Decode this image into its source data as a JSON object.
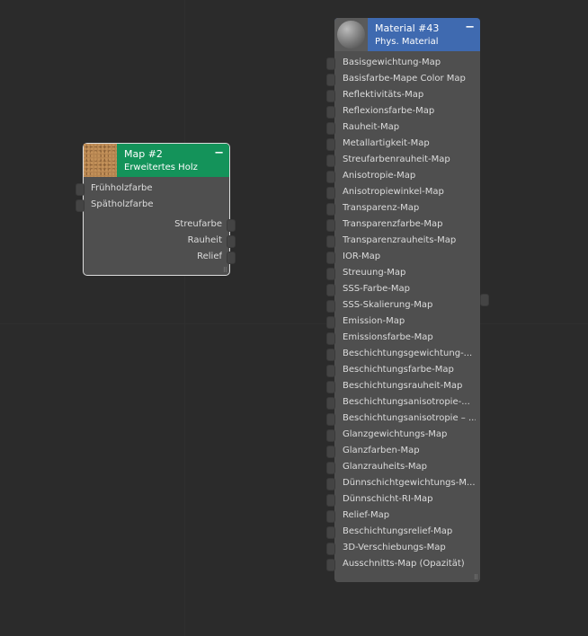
{
  "map_node": {
    "title": "Map #2",
    "subtitle": "Erweitertes Holz",
    "color": "#14935a",
    "inputs": [
      "Frühholzfarbe",
      "Spätholzfarbe"
    ],
    "outputs": [
      "Streufarbe",
      "Rauheit",
      "Relief"
    ]
  },
  "material_node": {
    "title": "Material #43",
    "subtitle": "Phys. Material",
    "color": "#3f6ab0",
    "inputs": [
      "Basisgewichtung-Map",
      "Basisfarbe-Mape Color Map",
      "Reflektivitäts-Map",
      "Reflexionsfarbe-Map",
      "Rauheit-Map",
      "Metallartigkeit-Map",
      "Streufarbenrauheit-Map",
      "Anisotropie-Map",
      "Anisotropiewinkel-Map",
      "Transparenz-Map",
      "Transparenzfarbe-Map",
      "Transparenzrauheits-Map",
      "IOR-Map",
      "Streuung-Map",
      "SSS-Farbe-Map",
      "SSS-Skalierung-Map",
      "Emission-Map",
      "Emissionsfarbe-Map",
      "Beschichtungsgewichtung-...",
      "Beschichtungsfarbe-Map",
      "Beschichtungsrauheit-Map",
      "Beschichtungsanisotropie-...",
      "Beschichtungsanisotropie – ...",
      "Glanzgewichtungs-Map",
      "Glanzfarben-Map",
      "Glanzrauheits-Map",
      "Dünnschichtgewichtungs-M...",
      "Dünnschicht-RI-Map",
      "Relief-Map",
      "Beschichtungsrelief-Map",
      "3D-Verschiebungs-Map",
      "Ausschnitts-Map (Opazität)"
    ]
  },
  "minimize_label": "−"
}
